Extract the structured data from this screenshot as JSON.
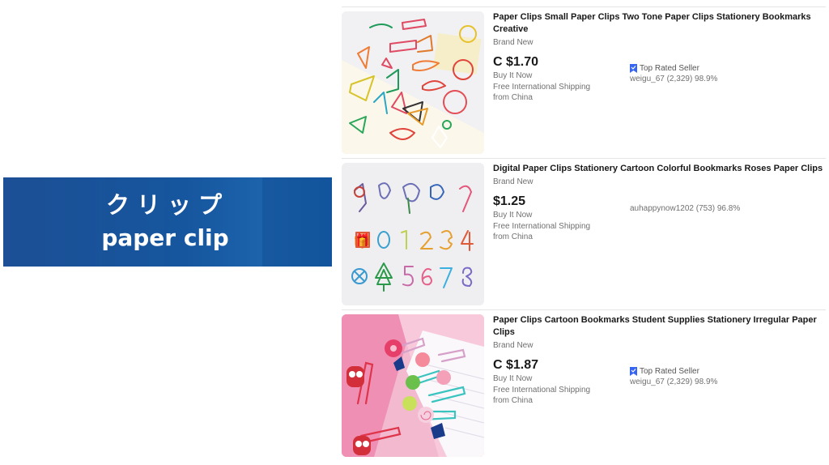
{
  "banner": {
    "jp": "クリップ",
    "en": "paper clip"
  },
  "listings": [
    {
      "title": "Paper Clips Small Paper Clips Two Tone Paper Clips Stationery Bookmarks Creative",
      "condition": "Brand New",
      "price": "C $1.70",
      "format": "Buy It Now",
      "shipping": "Free International Shipping",
      "origin": "from China",
      "top_rated": "Top Rated Seller",
      "seller": "weigu_67 (2,329) 98.9%"
    },
    {
      "title": "Digital Paper Clips Stationery Cartoon Colorful Bookmarks Roses Paper Clips",
      "condition": "Brand New",
      "price": "$1.25",
      "format": "Buy It Now",
      "shipping": "Free International Shipping",
      "origin": "from China",
      "top_rated": "",
      "seller": "auhappynow1202 (753) 96.8%"
    },
    {
      "title": "Paper Clips Cartoon Bookmarks Student Supplies Stationery Irregular Paper Clips",
      "condition": "Brand New",
      "price": "C $1.87",
      "format": "Buy It Now",
      "shipping": "Free International Shipping",
      "origin": "from China",
      "top_rated": "Top Rated Seller",
      "seller": "weigu_67 (2,329) 98.9%"
    }
  ],
  "colors": {
    "banner": "#1a5aa3",
    "top_rated_icon": "#3665f3"
  },
  "icons": {
    "top_rated": "top-rated-badge-icon"
  }
}
